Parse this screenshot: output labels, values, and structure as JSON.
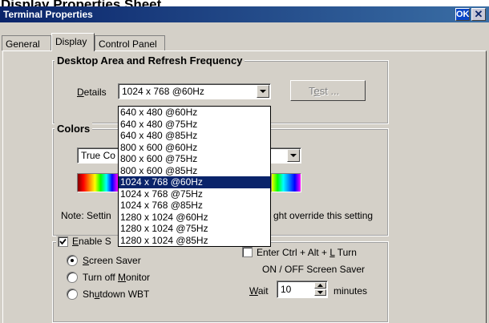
{
  "caption": "Display Properties Sheet",
  "window": {
    "title": "Terminal Properties",
    "ok_label": "OK",
    "close_glyph": "✕"
  },
  "tabs": [
    {
      "label": "General",
      "active": false
    },
    {
      "label": "Display",
      "active": true
    },
    {
      "label": "Control Panel",
      "active": false
    }
  ],
  "desktop_area": {
    "group_title": "Desktop Area and Refresh Frequency",
    "details_label": "Details",
    "details_accel": "D",
    "details_rest": "etails",
    "selected": "1024 x 768 @60Hz",
    "test_button": "Test ...",
    "test_accel_pre": "T",
    "test_accel": "e",
    "test_accel_post": "st ...",
    "options": [
      "640 x 480 @60Hz",
      "640 x 480 @75Hz",
      "640 x 480 @85Hz",
      "800 x 600 @60Hz",
      "800 x 600 @75Hz",
      "800 x 600 @85Hz",
      "1024 x 768 @60Hz",
      "1024 x 768 @75Hz",
      "1024 x 768 @85Hz",
      "1280 x 1024 @60Hz",
      "1280 x 1024 @75Hz",
      "1280 x 1024 @85Hz"
    ]
  },
  "colors": {
    "group_title": "Colors",
    "selected_visible": "True Co",
    "note_left": "Note: Settin",
    "note_right": "ght override this setting"
  },
  "screen_saver": {
    "enable_visible": "Enable S",
    "enable_accel": "E",
    "enable_rest": "nable S",
    "enable_checked": true,
    "radio_screen_saver": {
      "accel": "S",
      "rest": "creen Saver",
      "checked": true
    },
    "radio_turn_off": {
      "pre": "Turn off ",
      "accel": "M",
      "rest": "onitor",
      "checked": false
    },
    "radio_shutdown": {
      "pre": "Sh",
      "accel": "u",
      "rest": "tdown WBT",
      "checked": false
    },
    "hotkey_enabled": false,
    "hotkey_line1_pre": "Enter Ctrl + Alt + ",
    "hotkey_accel": "L",
    "hotkey_line1_post": " Turn",
    "hotkey_line2": "ON / OFF Screen Saver",
    "wait_accel": "W",
    "wait_rest": "ait",
    "wait_value": "10",
    "minutes_label": "minutes"
  },
  "theme": {
    "selection": "#0a246a",
    "face": "#d4d0c8"
  }
}
